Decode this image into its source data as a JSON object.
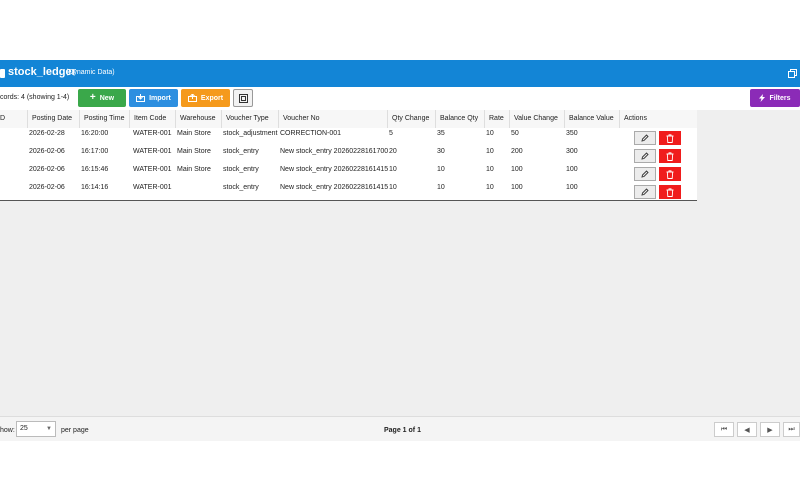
{
  "window": {
    "title": "stock_ledger",
    "subtitle": "(Dynamic Data)"
  },
  "toolbar": {
    "records_text": "cords: 4 (showing 1-4)",
    "new_label": "New",
    "import_label": "Import",
    "export_label": "Export",
    "filters_label": "Filters"
  },
  "table": {
    "columns": [
      "Posting Date",
      "Posting Time",
      "Item Code",
      "Warehouse",
      "Voucher Type",
      "Voucher No",
      "Qty Change",
      "Balance Qty",
      "Rate",
      "Value Change",
      "Balance Value",
      "Actions"
    ],
    "first_col_stub": "D",
    "rows": [
      [
        "2026-02-28",
        "16:20:00",
        "WATER-001",
        "Main Store",
        "stock_adjustment",
        "CORRECTION-001",
        "5",
        "35",
        "10",
        "50",
        "350"
      ],
      [
        "2026-02-06",
        "16:17:00",
        "WATER-001",
        "Main Store",
        "stock_entry",
        "New stock_entry 20260228161700",
        "20",
        "30",
        "10",
        "200",
        "300"
      ],
      [
        "2026-02-06",
        "16:15:46",
        "WATER-001",
        "Main Store",
        "stock_entry",
        "New stock_entry 20260228161415",
        "10",
        "10",
        "10",
        "100",
        "100"
      ],
      [
        "2026-02-06",
        "16:14:16",
        "WATER-001",
        "",
        "stock_entry",
        "New stock_entry 20260228161415",
        "10",
        "10",
        "10",
        "100",
        "100"
      ]
    ]
  },
  "footer": {
    "show_label": "how:",
    "page_size": "25",
    "per_page_label": "per page",
    "page_info": "Page 1 of 1"
  },
  "colors": {
    "titlebar": "#1385d6",
    "new": "#3aa84a",
    "import": "#2d8fe0",
    "export": "#f59a1c",
    "filters": "#8b2bb7",
    "delete": "#f01c1c"
  }
}
